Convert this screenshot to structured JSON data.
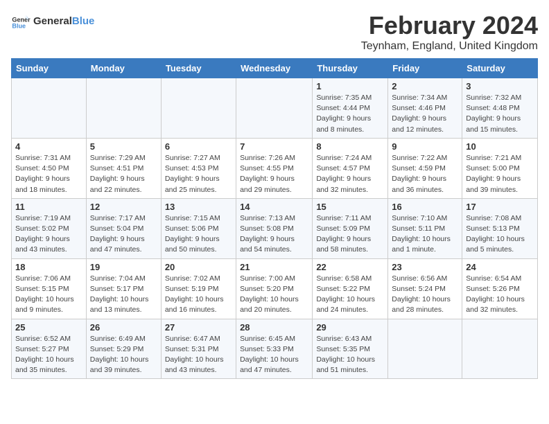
{
  "logo": {
    "text_general": "General",
    "text_blue": "Blue"
  },
  "header": {
    "month": "February 2024",
    "location": "Teynham, England, United Kingdom"
  },
  "weekdays": [
    "Sunday",
    "Monday",
    "Tuesday",
    "Wednesday",
    "Thursday",
    "Friday",
    "Saturday"
  ],
  "weeks": [
    [
      {
        "day": "",
        "info": ""
      },
      {
        "day": "",
        "info": ""
      },
      {
        "day": "",
        "info": ""
      },
      {
        "day": "",
        "info": ""
      },
      {
        "day": "1",
        "info": "Sunrise: 7:35 AM\nSunset: 4:44 PM\nDaylight: 9 hours\nand 8 minutes."
      },
      {
        "day": "2",
        "info": "Sunrise: 7:34 AM\nSunset: 4:46 PM\nDaylight: 9 hours\nand 12 minutes."
      },
      {
        "day": "3",
        "info": "Sunrise: 7:32 AM\nSunset: 4:48 PM\nDaylight: 9 hours\nand 15 minutes."
      }
    ],
    [
      {
        "day": "4",
        "info": "Sunrise: 7:31 AM\nSunset: 4:50 PM\nDaylight: 9 hours\nand 18 minutes."
      },
      {
        "day": "5",
        "info": "Sunrise: 7:29 AM\nSunset: 4:51 PM\nDaylight: 9 hours\nand 22 minutes."
      },
      {
        "day": "6",
        "info": "Sunrise: 7:27 AM\nSunset: 4:53 PM\nDaylight: 9 hours\nand 25 minutes."
      },
      {
        "day": "7",
        "info": "Sunrise: 7:26 AM\nSunset: 4:55 PM\nDaylight: 9 hours\nand 29 minutes."
      },
      {
        "day": "8",
        "info": "Sunrise: 7:24 AM\nSunset: 4:57 PM\nDaylight: 9 hours\nand 32 minutes."
      },
      {
        "day": "9",
        "info": "Sunrise: 7:22 AM\nSunset: 4:59 PM\nDaylight: 9 hours\nand 36 minutes."
      },
      {
        "day": "10",
        "info": "Sunrise: 7:21 AM\nSunset: 5:00 PM\nDaylight: 9 hours\nand 39 minutes."
      }
    ],
    [
      {
        "day": "11",
        "info": "Sunrise: 7:19 AM\nSunset: 5:02 PM\nDaylight: 9 hours\nand 43 minutes."
      },
      {
        "day": "12",
        "info": "Sunrise: 7:17 AM\nSunset: 5:04 PM\nDaylight: 9 hours\nand 47 minutes."
      },
      {
        "day": "13",
        "info": "Sunrise: 7:15 AM\nSunset: 5:06 PM\nDaylight: 9 hours\nand 50 minutes."
      },
      {
        "day": "14",
        "info": "Sunrise: 7:13 AM\nSunset: 5:08 PM\nDaylight: 9 hours\nand 54 minutes."
      },
      {
        "day": "15",
        "info": "Sunrise: 7:11 AM\nSunset: 5:09 PM\nDaylight: 9 hours\nand 58 minutes."
      },
      {
        "day": "16",
        "info": "Sunrise: 7:10 AM\nSunset: 5:11 PM\nDaylight: 10 hours\nand 1 minute."
      },
      {
        "day": "17",
        "info": "Sunrise: 7:08 AM\nSunset: 5:13 PM\nDaylight: 10 hours\nand 5 minutes."
      }
    ],
    [
      {
        "day": "18",
        "info": "Sunrise: 7:06 AM\nSunset: 5:15 PM\nDaylight: 10 hours\nand 9 minutes."
      },
      {
        "day": "19",
        "info": "Sunrise: 7:04 AM\nSunset: 5:17 PM\nDaylight: 10 hours\nand 13 minutes."
      },
      {
        "day": "20",
        "info": "Sunrise: 7:02 AM\nSunset: 5:19 PM\nDaylight: 10 hours\nand 16 minutes."
      },
      {
        "day": "21",
        "info": "Sunrise: 7:00 AM\nSunset: 5:20 PM\nDaylight: 10 hours\nand 20 minutes."
      },
      {
        "day": "22",
        "info": "Sunrise: 6:58 AM\nSunset: 5:22 PM\nDaylight: 10 hours\nand 24 minutes."
      },
      {
        "day": "23",
        "info": "Sunrise: 6:56 AM\nSunset: 5:24 PM\nDaylight: 10 hours\nand 28 minutes."
      },
      {
        "day": "24",
        "info": "Sunrise: 6:54 AM\nSunset: 5:26 PM\nDaylight: 10 hours\nand 32 minutes."
      }
    ],
    [
      {
        "day": "25",
        "info": "Sunrise: 6:52 AM\nSunset: 5:27 PM\nDaylight: 10 hours\nand 35 minutes."
      },
      {
        "day": "26",
        "info": "Sunrise: 6:49 AM\nSunset: 5:29 PM\nDaylight: 10 hours\nand 39 minutes."
      },
      {
        "day": "27",
        "info": "Sunrise: 6:47 AM\nSunset: 5:31 PM\nDaylight: 10 hours\nand 43 minutes."
      },
      {
        "day": "28",
        "info": "Sunrise: 6:45 AM\nSunset: 5:33 PM\nDaylight: 10 hours\nand 47 minutes."
      },
      {
        "day": "29",
        "info": "Sunrise: 6:43 AM\nSunset: 5:35 PM\nDaylight: 10 hours\nand 51 minutes."
      },
      {
        "day": "",
        "info": ""
      },
      {
        "day": "",
        "info": ""
      }
    ]
  ]
}
